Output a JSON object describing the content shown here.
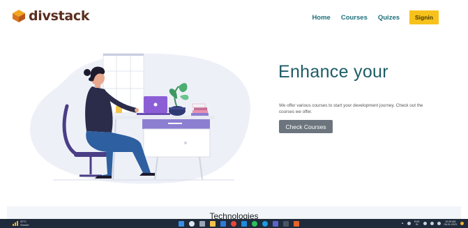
{
  "brand": {
    "name": "divstack"
  },
  "nav": {
    "items": [
      {
        "label": "Home"
      },
      {
        "label": "Courses"
      },
      {
        "label": "Quizes"
      }
    ],
    "signin_label": "Signin"
  },
  "hero": {
    "title": "Enhance your",
    "description": "We offer various courses to start your development journey. Check out the courses we offer.",
    "cta_label": "Check Courses"
  },
  "technologies": {
    "title": "Technologies"
  },
  "taskbar": {
    "weather_temp": "32°C",
    "weather_desc": "Smoke",
    "tray_lang": "ENG",
    "tray_lang_sub": "IN",
    "time": "10:28 AM",
    "date": "06-01-2023"
  },
  "colors": {
    "accent_teal": "#1d6f7a",
    "signin_yellow": "#f7c21b",
    "cta_gray": "#6c757d",
    "brand_brown": "#5a2e1e"
  }
}
